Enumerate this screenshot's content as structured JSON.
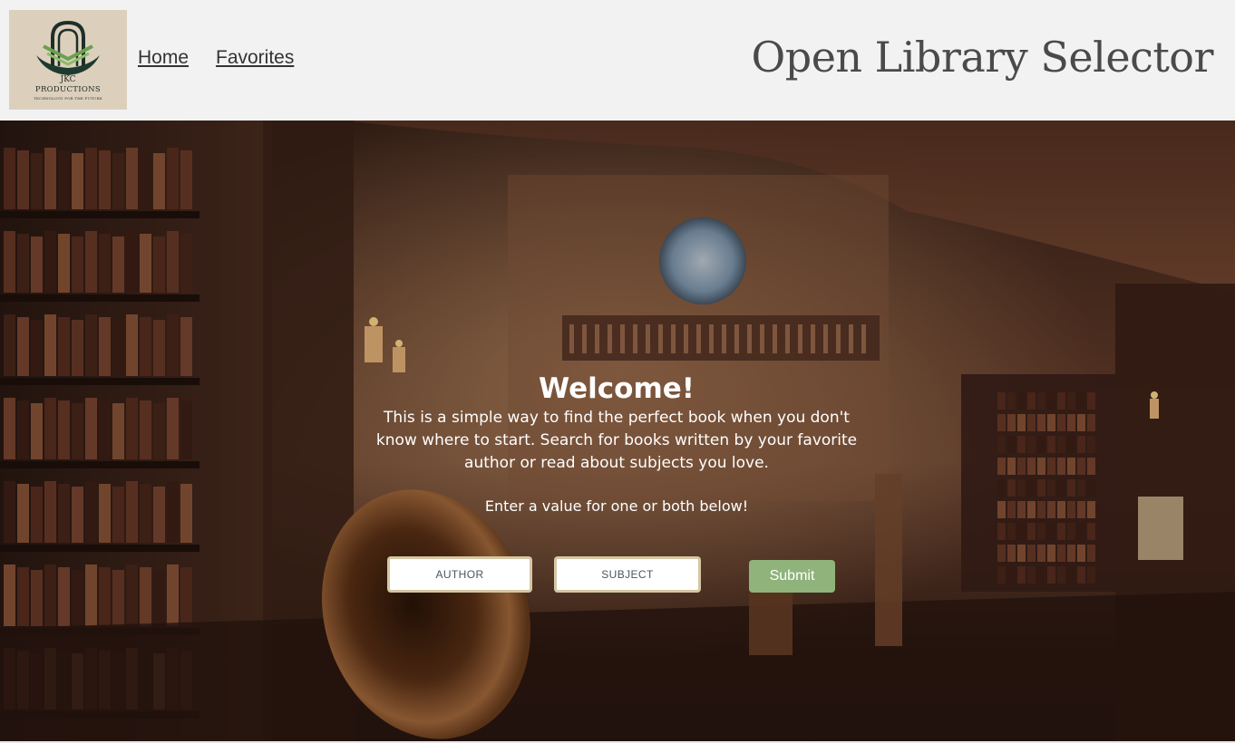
{
  "header": {
    "logo": {
      "icon": "jkc-productions-logo",
      "line1": "JKC",
      "line2": "PRODUCTIONS",
      "tagline": "TECHNOLOGY FOR THE FUTURE"
    },
    "nav": [
      {
        "label": "Home"
      },
      {
        "label": "Favorites"
      }
    ],
    "title": "Open Library Selector"
  },
  "hero": {
    "heading": "Welcome!",
    "intro": "This is a simple way to find the perfect book when you don't know where to start. Search for books written by your favorite author or read about subjects you love.",
    "prompt": "Enter a value for one or both below!",
    "author_placeholder": "AUTHOR",
    "subject_placeholder": "SUBJECT",
    "submit_label": "Submit"
  },
  "colors": {
    "header_bg": "#f2f2f2",
    "submit_bg": "#8fb37a",
    "input_border": "#d5c7a4",
    "logo_bg": "#dcd0bd"
  }
}
